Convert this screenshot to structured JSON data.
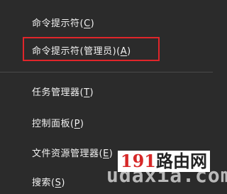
{
  "menu": {
    "items": [
      {
        "label": "命令提示符(",
        "accel": "C",
        "close": ")"
      },
      {
        "label": "命令提示符(管理员)(",
        "accel": "A",
        "close": ")"
      },
      {
        "label": "任务管理器(",
        "accel": "T",
        "close": ")"
      },
      {
        "label": "控制面板(",
        "accel": "P",
        "close": ")"
      },
      {
        "label": "文件资源管理器(",
        "accel": "E",
        "close": ")"
      },
      {
        "label": "搜索(",
        "accel": "S",
        "close": ")"
      }
    ],
    "highlight_color": "#e0252a"
  },
  "watermark": {
    "url_text": "udaxia.com",
    "sign_number": "191",
    "sign_text": "路由网"
  }
}
